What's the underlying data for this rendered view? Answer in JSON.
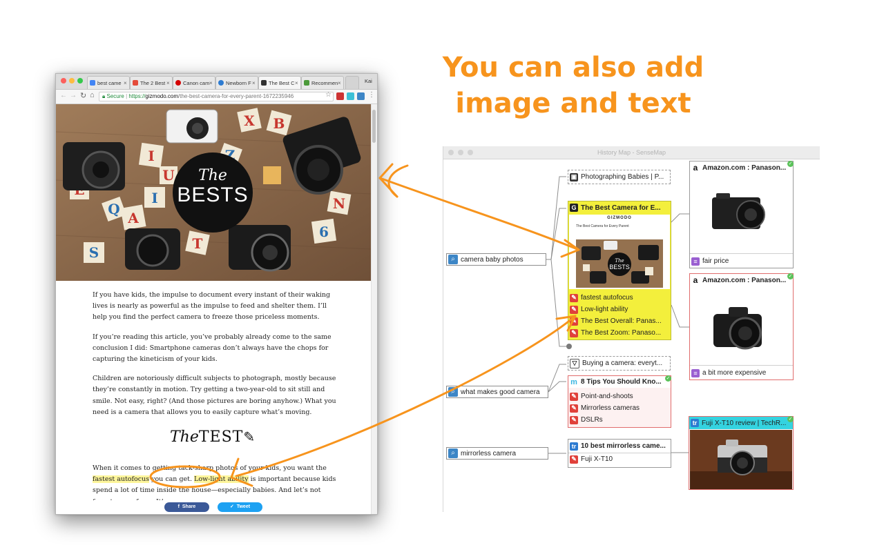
{
  "headline": {
    "line1": "You can also add",
    "line2": "image and text"
  },
  "browser": {
    "tabs": [
      {
        "label": "best came",
        "color": "#4285f4"
      },
      {
        "label": "The 2 Best",
        "color": "#e44b3a"
      },
      {
        "label": "Canon cam",
        "color": "#d40000"
      },
      {
        "label": "Newborn F",
        "color": "#2d7bd1"
      },
      {
        "label": "The Best C",
        "color": "#333333"
      },
      {
        "label": "Recommen",
        "color": "#4c9a3a"
      }
    ],
    "profile": "Kai",
    "secure_label": "Secure",
    "url_scheme": "https://",
    "url_domain": "gizmodo.com",
    "url_path": "/the-best-camera-for-every-parent-1672235946",
    "hero": {
      "the": "The",
      "bests": "BESTS"
    },
    "paragraphs": [
      "If you have kids, the impulse to document every instant of their waking lives is nearly as powerful as the impulse to feed and shelter them. I’ll help you find the perfect camera to freeze those priceless moments.",
      "If you’re reading this article, you’ve probably already come to the same conclusion I did: Smartphone cameras don’t always have the chops for capturing the kineticism of your kids.",
      "Children are notoriously difficult subjects to photograph, mostly because they’re constantly in motion. Try getting a two-year-old to sit still and smile. Not easy, right? (And those pictures are boring anyhow.) What you need is a camera that allows you to easily capture what’s moving."
    ],
    "test_heading_the": "The",
    "test_heading_test": "TEST",
    "last_para": {
      "pre": "When it comes to getting tack-sharp photos of your kids, you want the ",
      "hl1": "fastest autofocus",
      "mid": " you can get. ",
      "hl2": "Low-light ability",
      "post": " is important because kids spend a lot of time inside the house—especially babies. And let’s not forget ease of use. It’s"
    },
    "share_label": "Share",
    "tweet_label": "Tweet"
  },
  "sensemap": {
    "title": "History Map - SenseMap",
    "queries": [
      {
        "label": "camera baby photos"
      },
      {
        "label": "what makes good camera"
      },
      {
        "label": "mirrorless camera"
      }
    ],
    "photographing": "Photographing Babies | P...",
    "gizmodo_title": "The Best Camera for E...",
    "gizmodo_brand": "GIZMODO",
    "gizmodo_subtitle": "The Best Camera for Every Parent",
    "gizmodo_notes": [
      "fastest autofocus",
      "Low-light ability",
      "The Best Overall: Panas...",
      "The Best Zoom: Panaso..."
    ],
    "buying": "Buying a camera: everyt...",
    "tips_title": "8 Tips You Should Kno...",
    "tips_notes": [
      "Point-and-shoots",
      "Mirrorless cameras",
      "DSLRs"
    ],
    "mirrorless_title": "10 best mirrorless came...",
    "mirrorless_notes": [
      "Fuji X-T10"
    ],
    "amazon1": {
      "title": "Amazon.com : Panason...",
      "note": "fair price"
    },
    "amazon2": {
      "title": "Amazon.com : Panason...",
      "note": "a bit more expensive"
    },
    "fuji": {
      "title": "Fuji X-T10 review | TechR..."
    },
    "accent_color": "#f7941d",
    "highlight_color": "#f3ef3c",
    "note_border_color": "#e06c6c"
  }
}
